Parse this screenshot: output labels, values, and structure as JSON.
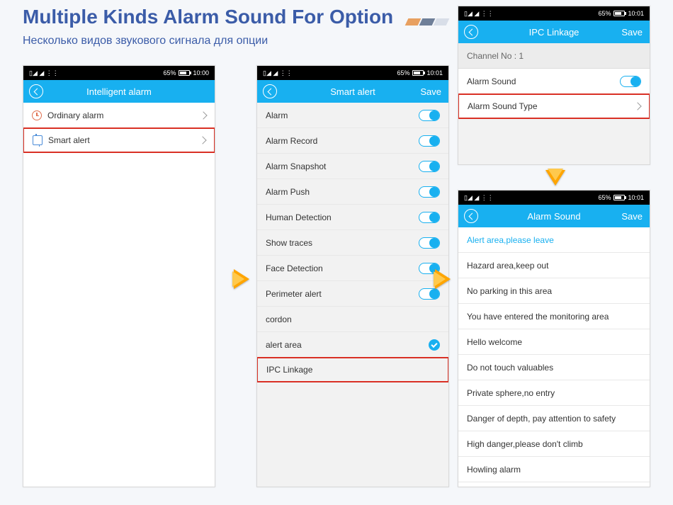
{
  "header": {
    "title": "Multiple Kinds Alarm Sound For Option",
    "subtitle": "Несколько видов звукового сигнала для опции"
  },
  "status": {
    "battery": "65%",
    "time1": "10:00",
    "time2": "10:01"
  },
  "nav": {
    "save": "Save"
  },
  "screen1": {
    "title": "Intelligent alarm",
    "items": [
      {
        "label": "Ordinary alarm",
        "icon": "alarm"
      },
      {
        "label": "Smart alert",
        "icon": "smart",
        "highlighted": true
      }
    ]
  },
  "screen2": {
    "title": "Smart alert",
    "items": [
      {
        "label": "Alarm",
        "type": "toggle"
      },
      {
        "label": "Alarm Record",
        "type": "toggle"
      },
      {
        "label": "Alarm Snapshot",
        "type": "toggle"
      },
      {
        "label": "Alarm Push",
        "type": "toggle"
      },
      {
        "label": "Human Detection",
        "type": "toggle"
      },
      {
        "label": "Show traces",
        "type": "toggle"
      },
      {
        "label": "Face Detection",
        "type": "toggle"
      },
      {
        "label": "Perimeter alert",
        "type": "toggle"
      },
      {
        "label": "cordon",
        "type": "none"
      },
      {
        "label": "alert area",
        "type": "check"
      },
      {
        "label": "IPC Linkage",
        "type": "none",
        "highlighted": true
      }
    ]
  },
  "screen3": {
    "title": "IPC Linkage",
    "channel": "Channel No : 1",
    "items": [
      {
        "label": "Alarm Sound",
        "type": "toggle"
      },
      {
        "label": "Alarm Sound Type",
        "type": "chevron",
        "highlighted": true
      }
    ]
  },
  "screen4": {
    "title": "Alarm Sound",
    "items": [
      {
        "label": "Alert area,please leave",
        "selected": true
      },
      {
        "label": "Hazard area,keep out"
      },
      {
        "label": "No parking in this area"
      },
      {
        "label": "You have entered the monitoring area"
      },
      {
        "label": "Hello welcome"
      },
      {
        "label": "Do not touch valuables"
      },
      {
        "label": "Private sphere,no entry"
      },
      {
        "label": "Danger of depth, pay attention to safety"
      },
      {
        "label": "High danger,please don't climb"
      },
      {
        "label": "Howling alarm"
      }
    ]
  }
}
